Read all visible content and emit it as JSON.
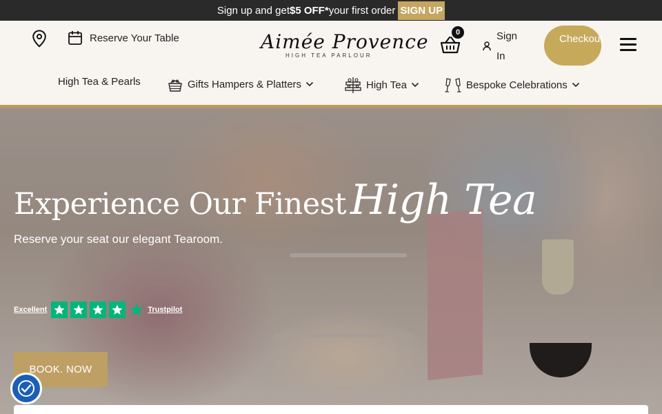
{
  "announcement": {
    "prefix": "Sign up and get ",
    "highlight": "$5 OFF*",
    "suffix": " your first order",
    "button": "SIGN UP"
  },
  "header": {
    "reserve_label": "Reserve Your Table",
    "logo_script": "Aimée Provence",
    "logo_sub": "HIGH TEA PARLOUR",
    "cart_count": "0",
    "signin_label": "Sign In",
    "checkout_label": "Checkout"
  },
  "nav": {
    "items": [
      {
        "label": "High Tea & Pearls"
      },
      {
        "label": "Gifts Hampers & Platters"
      },
      {
        "label": "High Tea"
      },
      {
        "label": "Bespoke Celebrations"
      }
    ]
  },
  "hero": {
    "title_plain": "Experience Our Finest",
    "title_italic": "High Tea",
    "subtitle": "Reserve your seat our elegant Tearoom.",
    "rating_label": "Excellent",
    "rating_stars": 4.5,
    "rating_brand": "Trustpilot",
    "cta": "BOOK. NOW"
  },
  "colors": {
    "gold": "#c4a660",
    "dark": "#2a2a2a",
    "trustpilot": "#00b67a",
    "accessibility": "#1a5fb4"
  }
}
